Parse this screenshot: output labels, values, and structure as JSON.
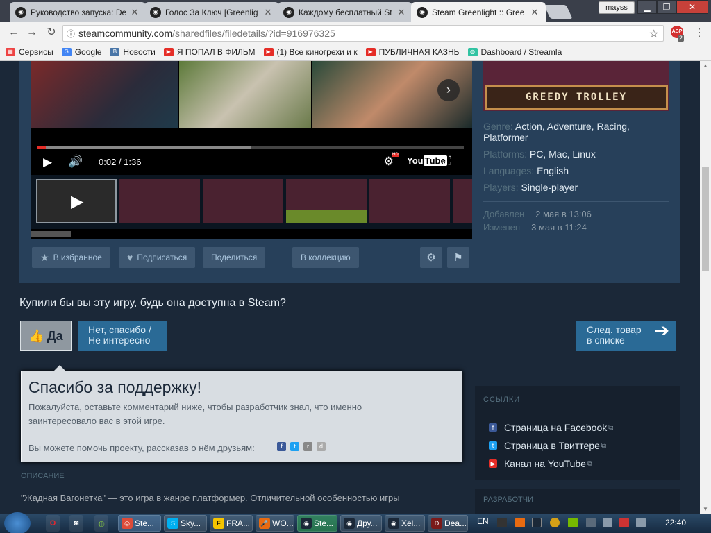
{
  "browser": {
    "tabs": [
      {
        "title": "Руководство запуска: De",
        "favicon": "steam-icon"
      },
      {
        "title": "Голос За Ключ [Greenlig",
        "favicon": "steam-icon"
      },
      {
        "title": "Каждому бесплатный St",
        "favicon": "steam-icon"
      },
      {
        "title": "Steam Greenlight :: Gree",
        "favicon": "steam-icon",
        "active": true
      }
    ],
    "user": "mayss",
    "url_host": "steamcommunity.com",
    "url_path": "/sharedfiles/filedetails/?id=916976325",
    "extension_badge": "ABP",
    "extension_count": "2",
    "bookmarks": [
      {
        "label": "Сервисы",
        "icon": "apps-icon",
        "color": "#e44"
      },
      {
        "label": "Google",
        "icon": "google-icon",
        "color": "#4285f4"
      },
      {
        "label": "Новости",
        "icon": "vk-icon",
        "color": "#4a76a8"
      },
      {
        "label": "Я ПОПАЛ В ФИЛЬМ",
        "icon": "youtube-icon",
        "color": "#e52d27"
      },
      {
        "label": "(1) Все киногрехи и к",
        "icon": "youtube-icon",
        "color": "#e52d27"
      },
      {
        "label": "ПУБЛИЧНАЯ КАЗНЬ",
        "icon": "youtube-icon",
        "color": "#e52d27"
      },
      {
        "label": "Dashboard / Streamla",
        "icon": "streamlabs-icon",
        "color": "#31c3a2"
      }
    ]
  },
  "player": {
    "time": "0:02 / 1:36",
    "progress": 0.02,
    "hd_label": "HD",
    "youtube_label": "You",
    "youtube_label2": "Tube"
  },
  "game": {
    "banner_title": "GREEDY TROLLEY",
    "genre_label": "Genre:",
    "genres": "Action, Adventure, Racing, Platformer",
    "platforms_label": "Platforms:",
    "platforms": "PC, Mac, Linux",
    "languages_label": "Languages:",
    "languages": "English",
    "players_label": "Players:",
    "players": "Single-player",
    "added_label": "Добавлен",
    "added": "2 мая в 13:06",
    "updated_label": "Изменен",
    "updated": "3 мая в 11:24"
  },
  "actions": {
    "favorite": "В избранное",
    "subscribe": "Подписаться",
    "share": "Поделиться",
    "collection": "В коллекцию"
  },
  "vote": {
    "question": "Купили бы вы эту игру, будь она доступна в Steam?",
    "yes": "Да",
    "no_line1": "Нет, спасибо /",
    "no_line2": "Не интересно",
    "next_line1": "След. товар",
    "next_line2": "в списке"
  },
  "thanks": {
    "title": "Спасибо за поддержку!",
    "text": "Пожалуйста, оставьте комментарий ниже, чтобы разработчик знал, что именно заинтересовало вас в этой игре.",
    "share_text": "Вы можете помочь проекту, рассказав о нём друзьям:"
  },
  "description": {
    "heading": "ОПИСАНИЕ",
    "text": "\"Жадная Вагонетка\" — это игра в жанре платформер. Отличительной особенностью игры"
  },
  "links": {
    "heading": "ССЫЛКИ",
    "items": [
      {
        "label": "Страница на Facebook",
        "icon": "facebook-icon",
        "color": "#3b5998"
      },
      {
        "label": "Страница в Твиттере",
        "icon": "twitter-icon",
        "color": "#1da1f2"
      },
      {
        "label": "Канал на YouTube",
        "icon": "youtube-icon",
        "color": "#e52d27"
      }
    ]
  },
  "developers": {
    "heading": "РАЗРАБОТЧИ"
  },
  "taskbar": {
    "tasks": [
      {
        "label": "Ste...",
        "icon": "chrome-icon",
        "color": "#dd4b39"
      },
      {
        "label": "Sky...",
        "icon": "skype-icon",
        "color": "#00aff0"
      },
      {
        "label": "FRA...",
        "icon": "fraps-icon",
        "color": "#f5c400"
      },
      {
        "label": "WO...",
        "icon": "mic-icon",
        "color": "#e86a10"
      },
      {
        "label": "Ste...",
        "icon": "steam-icon",
        "color": "#1b2838"
      },
      {
        "label": "Дру...",
        "icon": "steam-icon",
        "color": "#1b2838"
      },
      {
        "label": "Xel...",
        "icon": "steam-icon",
        "color": "#1b2838"
      },
      {
        "label": "Dea...",
        "icon": "game-icon",
        "color": "#7a1a1a"
      }
    ],
    "lang": "EN",
    "clock": "22:40"
  }
}
